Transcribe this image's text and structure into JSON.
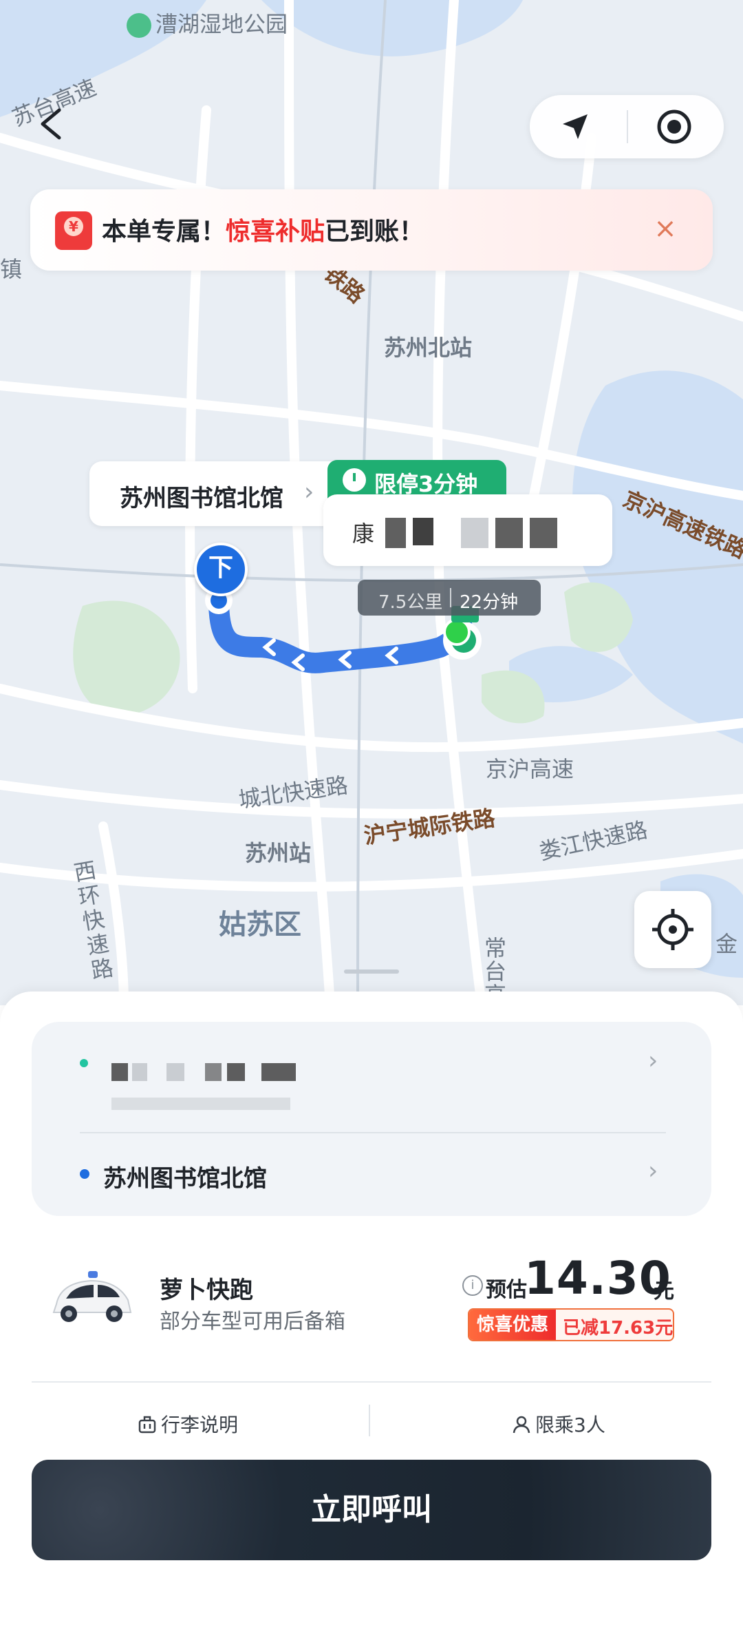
{
  "map": {
    "labels": {
      "park": "漕湖湿地公园",
      "suzhou_north": "苏州北站",
      "jinghu_rail": "京沪高速铁路",
      "jinghu_hwy": "京沪高速",
      "chengbei": "城北快速路",
      "hu_ning": "沪宁城际铁路",
      "loujiang": "娄江快速路",
      "suzhou_station": "苏州站",
      "gusu": "姑苏区",
      "xihuan": "西环快速路",
      "sutai": "苏台高速",
      "railway_partial": "铁路",
      "changtai": "常台高",
      "zhen": "镇",
      "jin": "金"
    },
    "destination_tag": "苏州图书馆北馆",
    "stop_badge": "限停3分钟",
    "pickup_code_partial": "康",
    "distance": "7.5公里",
    "duration": "22分钟",
    "dropoff_pin": "下"
  },
  "banner": {
    "prefix": "本单专属！",
    "highlight": "惊喜补贴",
    "suffix": "已到账！",
    "close_glyph": "×"
  },
  "sheet": {
    "destination": "苏州图书馆北馆",
    "service": {
      "name": "萝卜快跑",
      "subtitle": "部分车型可用后备箱",
      "estimate_label": "预估",
      "price": "14.30",
      "currency": "元",
      "promo_tag": "惊喜优惠",
      "promo_discount": "已减17.63元"
    },
    "footer": {
      "luggage": "行李说明",
      "passengers": "限乘3人"
    },
    "call_button": "立即呼叫"
  },
  "colors": {
    "route_blue": "#3d7be6",
    "pickup_green": "#1fae72",
    "accent_red": "#ee2c2c"
  }
}
